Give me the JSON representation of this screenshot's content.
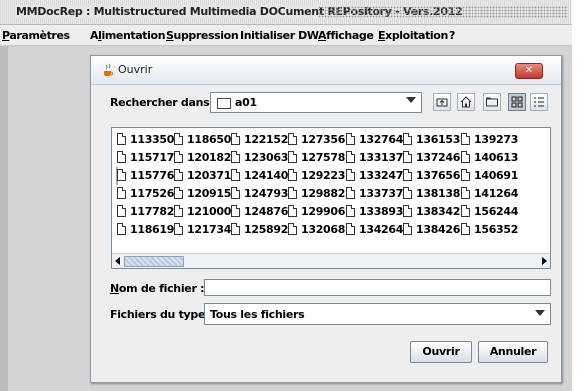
{
  "app": {
    "title": "MMDocRep : Multistructured Multimedia DOCument REPository - Vers.2012"
  },
  "menubar": {
    "items": [
      {
        "pre": "",
        "u": "P",
        "post": "aramètres"
      },
      {
        "pre": "A",
        "u": "l",
        "post": "imentation"
      },
      {
        "pre": "",
        "u": "S",
        "post": "uppression"
      },
      {
        "pre": "Initialiser DW",
        "u": "",
        "post": ""
      },
      {
        "pre": "",
        "u": "A",
        "post": "ffichage"
      },
      {
        "pre": "",
        "u": "E",
        "post": "xploitation"
      },
      {
        "pre": "?",
        "u": "",
        "post": ""
      }
    ]
  },
  "dialog": {
    "title": "Ouvrir",
    "look_in_label": "Rechercher dans :",
    "look_in_value": "a01",
    "files": [
      [
        "113350",
        "118650",
        "122152",
        "127356",
        "132764",
        "136153",
        "139273"
      ],
      [
        "115717",
        "120182",
        "123063",
        "127578",
        "133137",
        "137246",
        "140613"
      ],
      [
        "115776",
        "120371",
        "124140",
        "129223",
        "133247",
        "137656",
        "140691"
      ],
      [
        "117526",
        "120915",
        "124793",
        "129882",
        "133737",
        "138138",
        "141264"
      ],
      [
        "117782",
        "121000",
        "124876",
        "129906",
        "133893",
        "138342",
        "156244"
      ],
      [
        "118619",
        "121734",
        "125892",
        "132068",
        "134264",
        "138426",
        "156352"
      ]
    ],
    "filename_label_u": "N",
    "filename_label_rest": "om de fichier :",
    "filename_value": "",
    "filetype_label": "Fichiers du type :",
    "filetype_value": "Tous les fichiers",
    "open_label": "Ouvrir",
    "cancel_label": "Annuler"
  }
}
